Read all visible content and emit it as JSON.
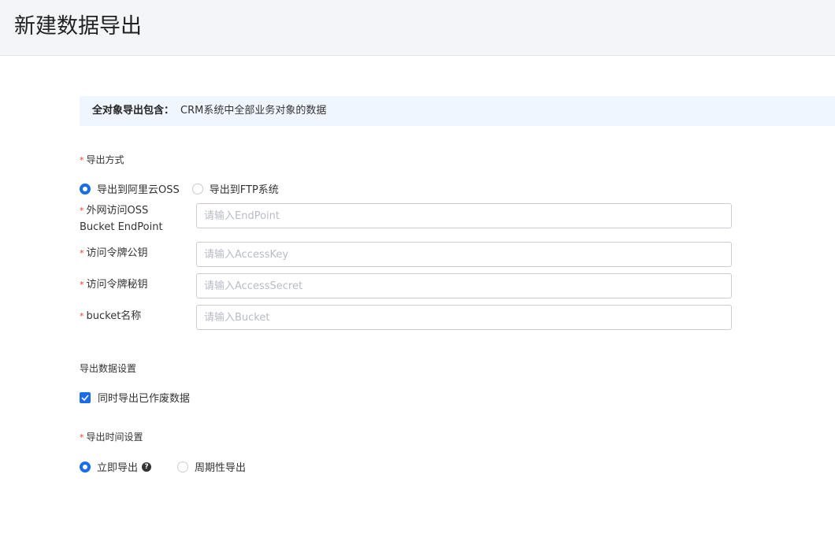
{
  "header": {
    "title": "新建数据导出"
  },
  "banner": {
    "label": "全对象导出包含：",
    "text": "CRM系统中全部业务对象的数据"
  },
  "export_method": {
    "label": "导出方式",
    "required_mark": "*",
    "options": [
      {
        "label": "导出到阿里云OSS",
        "checked": true
      },
      {
        "label": "导出到FTP系统",
        "checked": false
      }
    ]
  },
  "fields": [
    {
      "label_line1": "外网访问OSS",
      "label_line2": "Bucket EndPoint",
      "placeholder": "请输入EndPoint",
      "value": ""
    },
    {
      "label_line1": "访问令牌公钥",
      "placeholder": "请输入AccessKey",
      "value": ""
    },
    {
      "label_line1": "访问令牌秘钥",
      "placeholder": "请输入AccessSecret",
      "value": ""
    },
    {
      "label_line1": "bucket名称",
      "placeholder": "请输入Bucket",
      "value": ""
    }
  ],
  "data_settings": {
    "label": "导出数据设置",
    "checkbox_label": "同时导出已作废数据",
    "checked": true
  },
  "time_settings": {
    "label": "导出时间设置",
    "required_mark": "*",
    "options": [
      {
        "label": "立即导出",
        "checked": true
      },
      {
        "label": "周期性导出",
        "checked": false
      }
    ],
    "help_glyph": "?"
  },
  "colors": {
    "accent": "#1a6ce8",
    "required": "#f04134",
    "banner_bg": "#f0f6ff",
    "header_bg": "#f4f5f8"
  }
}
